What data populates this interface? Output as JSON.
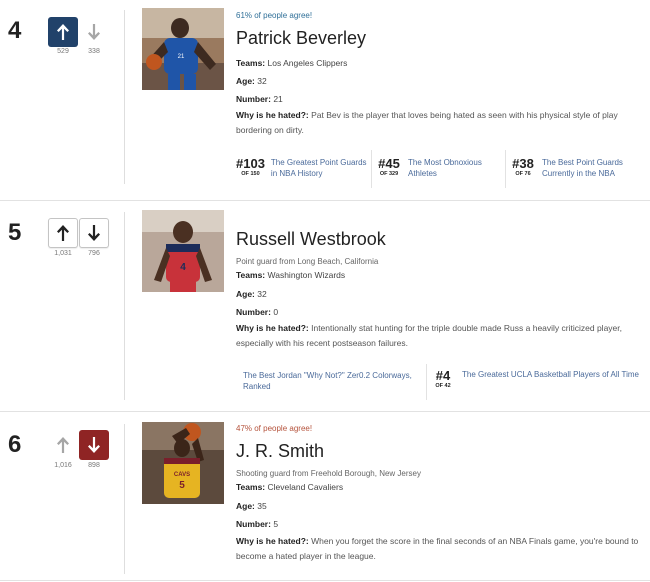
{
  "items": [
    {
      "rank": "4",
      "agree": "61% of people agree!",
      "agree_color": "#2f6f98",
      "up_count": "529",
      "down_count": "338",
      "name": "Patrick Beverley",
      "teams_label": "Teams:",
      "teams": "Los Angeles Clippers",
      "age_label": "Age:",
      "age": "32",
      "number_label": "Number:",
      "number": "21",
      "why_label": "Why is he hated?:",
      "why": "Pat Bev is the player that loves being hated as seen with his physical style of play bordering on dirty.",
      "lists": [
        {
          "rank": "#103",
          "of": "OF 150",
          "title_1": "The Greatest Point Guards",
          "title_2": "in NBA History"
        },
        {
          "rank": "#45",
          "of": "OF 329",
          "title_1": "The Most Obnoxious",
          "title_2": "Athletes"
        },
        {
          "rank": "#38",
          "of": "OF 76",
          "title_1": "The Best Point Guards",
          "title_2": "Currently in the NBA"
        }
      ]
    },
    {
      "rank": "5",
      "up_count": "1,031",
      "down_count": "796",
      "name": "Russell Westbrook",
      "subtitle": "Point guard from Long Beach, California",
      "teams_label": "Teams:",
      "teams": "Washington Wizards",
      "age_label": "Age:",
      "age": "32",
      "number_label": "Number:",
      "number": "0",
      "why_label": "Why is he hated?:",
      "why": "Intentionally stat hunting for the triple double made Russ a heavily criticized player, especially with his recent postseason failures.",
      "lists": [
        {
          "title_1": "The Best Jordan \"Why Not?\" Zer0.2 Colorways,",
          "title_2": "Ranked"
        },
        {
          "rank": "#4",
          "of": "OF 42",
          "title_1": "The Greatest UCLA Basketball Players of All Time"
        }
      ]
    },
    {
      "rank": "6",
      "agree": "47% of people agree!",
      "agree_color": "#b5533c",
      "up_count": "1,016",
      "down_count": "898",
      "name": "J. R. Smith",
      "subtitle": "Shooting guard from Freehold Borough, New Jersey",
      "teams_label": "Teams:",
      "teams": "Cleveland Cavaliers",
      "age_label": "Age:",
      "age": "35",
      "number_label": "Number:",
      "number": "5",
      "why_label": "Why is he hated?:",
      "why": "When you forget the score in the final seconds of an NBA Finals game, you're bound to become a hated player in the league."
    }
  ],
  "colors": {
    "upvote_active": "#21426a",
    "downvote_active": "#8f2424",
    "link": "#4a6a9a"
  },
  "icons": {
    "up": "arrow-up-icon",
    "down": "arrow-down-icon"
  }
}
